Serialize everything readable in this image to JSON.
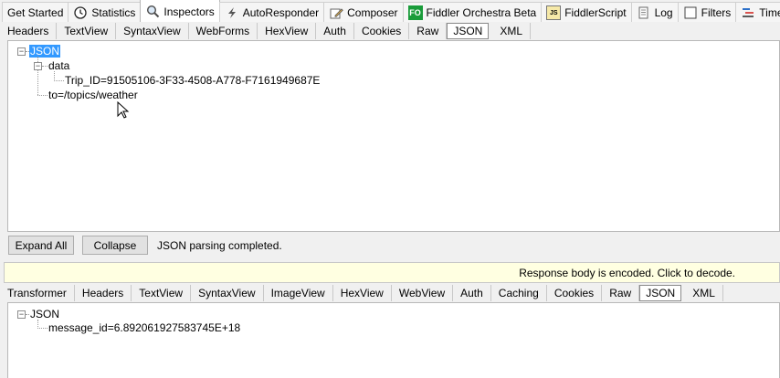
{
  "main_tabs": [
    {
      "label": "Get Started",
      "icon": "none"
    },
    {
      "label": "Statistics",
      "icon": "clock-icon"
    },
    {
      "label": "Inspectors",
      "icon": "magnifier-icon",
      "active": true
    },
    {
      "label": "AutoResponder",
      "icon": "lightning-icon"
    },
    {
      "label": "Composer",
      "icon": "pencil-icon"
    },
    {
      "label": "Fiddler Orchestra Beta",
      "icon": "fo-icon",
      "icon_text": "FO"
    },
    {
      "label": "FiddlerScript",
      "icon": "js-icon",
      "icon_text": "JS"
    },
    {
      "label": "Log",
      "icon": "log-icon"
    },
    {
      "label": "Filters",
      "icon": "checkbox-icon"
    },
    {
      "label": "Timeline",
      "icon": "timeline-icon"
    }
  ],
  "request_tabs": [
    "Headers",
    "TextView",
    "SyntaxView",
    "WebForms",
    "HexView",
    "Auth",
    "Cookies",
    "Raw",
    "JSON",
    "XML"
  ],
  "request_active": "JSON",
  "request_tree": {
    "root": "JSON",
    "data": "data",
    "trip": "Trip_ID=91505106-3F33-4508-A778-F7161949687E",
    "to": "to=/topics/weather"
  },
  "buttons": {
    "expand_all": "Expand All",
    "collapse": "Collapse"
  },
  "status_text": "JSON parsing completed.",
  "info_bar": "Response body is encoded. Click to decode.",
  "response_tabs": [
    "Transformer",
    "Headers",
    "TextView",
    "SyntaxView",
    "ImageView",
    "HexView",
    "WebView",
    "Auth",
    "Caching",
    "Cookies",
    "Raw",
    "JSON",
    "XML"
  ],
  "response_active": "JSON",
  "response_tree": {
    "root": "JSON",
    "message": "message_id=6.892061927583745E+18"
  },
  "colors": {
    "selection": "#3399ff",
    "info_bar_bg": "#ffffe1",
    "fo_icon": "#1a9c3a"
  }
}
